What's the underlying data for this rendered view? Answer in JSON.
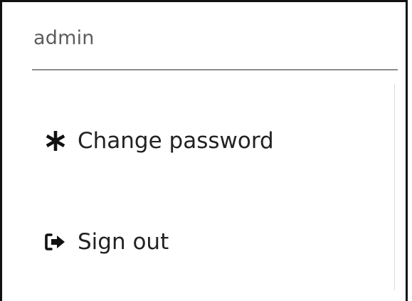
{
  "user_menu": {
    "username": "admin",
    "items": [
      {
        "label": "Change password",
        "icon": "asterisk-icon"
      },
      {
        "label": "Sign out",
        "icon": "sign-out-icon"
      }
    ]
  }
}
